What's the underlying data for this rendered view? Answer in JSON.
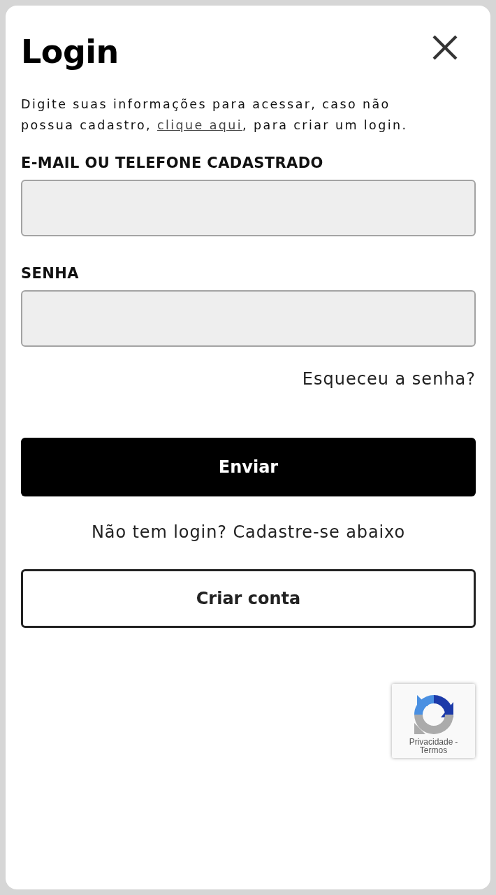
{
  "dialog": {
    "title": "Login"
  },
  "intro": {
    "text_before": "Digite suas informações para acessar, caso não possua cadastro, ",
    "link": "clique aqui",
    "text_after": ", para criar um login."
  },
  "fields": [
    {
      "label": "E-MAIL OU TELEFONE CADASTRADO"
    },
    {
      "label": "SENHA"
    }
  ],
  "forgot_password_link": "Esqueceu a senha?",
  "submit_button": "Enviar",
  "signup_prompt": "Não tem login? Cadastre-se abaixo",
  "create_account_button": "Criar conta",
  "recaptcha": {
    "privacy_link": "Privacidade",
    "separator": "-",
    "terms_link": "Termos"
  }
}
